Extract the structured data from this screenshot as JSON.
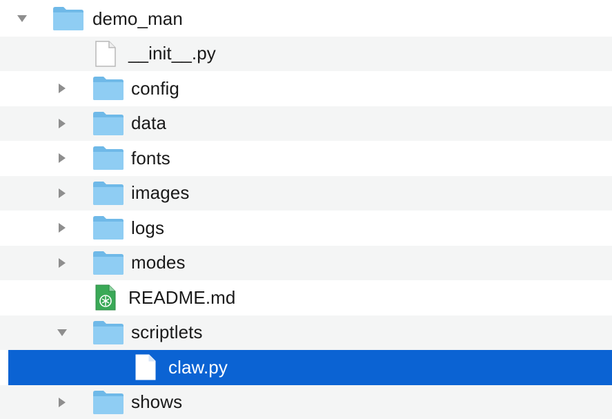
{
  "tree": {
    "root": {
      "name": "demo_man",
      "expanded": true,
      "icon": "folder-icon"
    },
    "items": [
      {
        "name": "__init__.py",
        "kind": "file",
        "icon": "python-file-icon"
      },
      {
        "name": "config",
        "kind": "folder",
        "expanded": false,
        "icon": "folder-icon"
      },
      {
        "name": "data",
        "kind": "folder",
        "expanded": false,
        "icon": "folder-icon"
      },
      {
        "name": "fonts",
        "kind": "folder",
        "expanded": false,
        "icon": "folder-icon"
      },
      {
        "name": "images",
        "kind": "folder",
        "expanded": false,
        "icon": "folder-icon"
      },
      {
        "name": "logs",
        "kind": "folder",
        "expanded": false,
        "icon": "folder-icon"
      },
      {
        "name": "modes",
        "kind": "folder",
        "expanded": false,
        "icon": "folder-icon"
      },
      {
        "name": "README.md",
        "kind": "file",
        "icon": "markdown-file-icon"
      },
      {
        "name": "scriptlets",
        "kind": "folder",
        "expanded": true,
        "icon": "folder-icon"
      },
      {
        "name": "claw.py",
        "kind": "file",
        "selected": true,
        "icon": "python-file-icon"
      },
      {
        "name": "shows",
        "kind": "folder",
        "expanded": false,
        "icon": "folder-icon"
      }
    ]
  },
  "colors": {
    "selection": "#0b63d3",
    "folder": "#7cc4ef",
    "alt_row": "#f4f5f5",
    "readme_icon": "#3aa957"
  }
}
